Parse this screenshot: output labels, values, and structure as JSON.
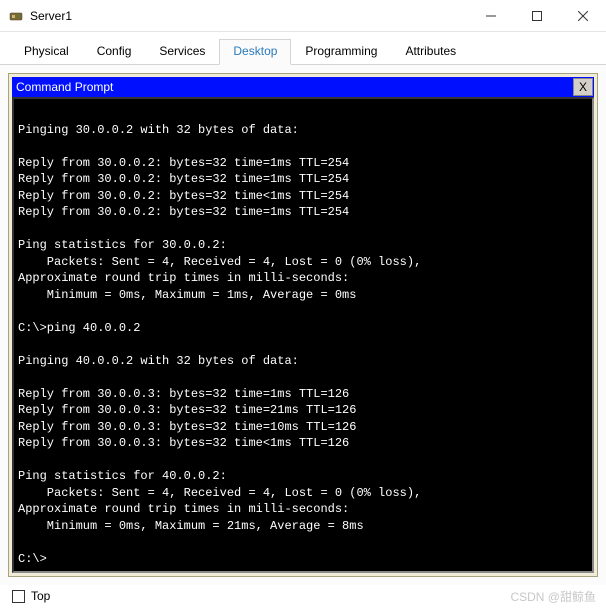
{
  "window": {
    "title": "Server1"
  },
  "tabs": {
    "t0": "Physical",
    "t1": "Config",
    "t2": "Services",
    "t3": "Desktop",
    "t4": "Programming",
    "t5": "Attributes",
    "active": "Desktop"
  },
  "cmd": {
    "title": "Command Prompt",
    "close": "X",
    "output": "\nPinging 30.0.0.2 with 32 bytes of data:\n\nReply from 30.0.0.2: bytes=32 time=1ms TTL=254\nReply from 30.0.0.2: bytes=32 time=1ms TTL=254\nReply from 30.0.0.2: bytes=32 time<1ms TTL=254\nReply from 30.0.0.2: bytes=32 time=1ms TTL=254\n\nPing statistics for 30.0.0.2:\n    Packets: Sent = 4, Received = 4, Lost = 0 (0% loss),\nApproximate round trip times in milli-seconds:\n    Minimum = 0ms, Maximum = 1ms, Average = 0ms\n\nC:\\>ping 40.0.0.2\n\nPinging 40.0.0.2 with 32 bytes of data:\n\nReply from 30.0.0.3: bytes=32 time=1ms TTL=126\nReply from 30.0.0.3: bytes=32 time=21ms TTL=126\nReply from 30.0.0.3: bytes=32 time=10ms TTL=126\nReply from 30.0.0.3: bytes=32 time<1ms TTL=126\n\nPing statistics for 40.0.0.2:\n    Packets: Sent = 4, Received = 4, Lost = 0 (0% loss),\nApproximate round trip times in milli-seconds:\n    Minimum = 0ms, Maximum = 21ms, Average = 8ms\n\nC:\\>"
  },
  "bottom": {
    "top_label": "Top"
  },
  "watermark": "CSDN @甜鲸鱼"
}
